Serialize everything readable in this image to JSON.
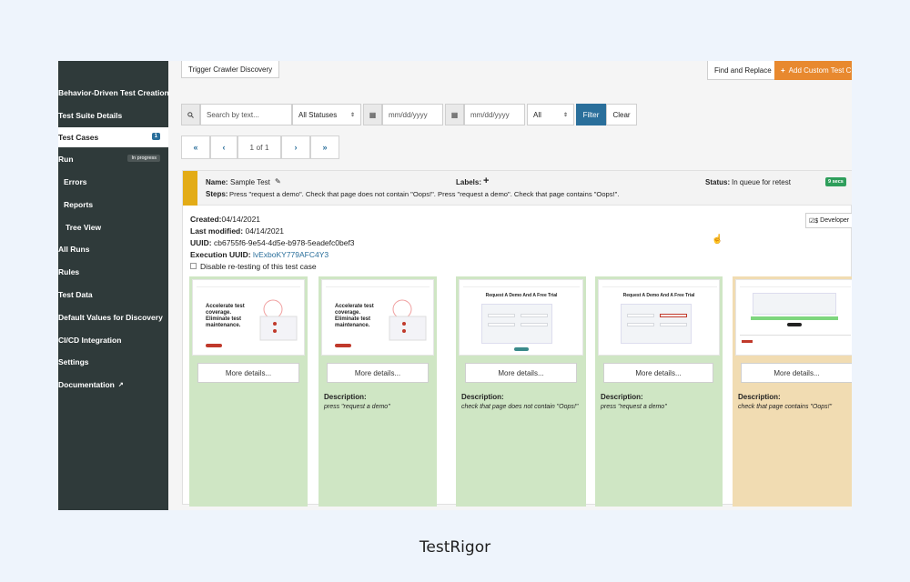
{
  "sidebar": {
    "items": [
      {
        "label": "Behavior-Driven Test Creation"
      },
      {
        "label": "Test Suite Details"
      },
      {
        "label": "Test Cases",
        "badge": "1"
      },
      {
        "label": "Run",
        "pill": "In progress"
      },
      {
        "label": "Errors"
      },
      {
        "label": "Reports"
      },
      {
        "label": "Tree View"
      },
      {
        "label": "All Runs"
      },
      {
        "label": "Rules"
      },
      {
        "label": "Test Data"
      },
      {
        "label": "Default Values for Discovery"
      },
      {
        "label": "CI/CD Integration"
      },
      {
        "label": "Settings"
      },
      {
        "label": "Documentation"
      }
    ]
  },
  "toolbar": {
    "trigger_label": "Trigger Crawler Discovery",
    "find_replace_label": "Find and Replace",
    "add_custom_label": "Add Custom Test C"
  },
  "filters": {
    "search_placeholder": "Search by text...",
    "status_value": "All Statuses",
    "date_from_placeholder": "mm/dd/yyyy",
    "date_to_placeholder": "mm/dd/yyyy",
    "scope_value": "All",
    "filter_label": "Filter",
    "clear_label": "Clear"
  },
  "pager": {
    "first": "«",
    "prev": "‹",
    "page_text": "1 of 1",
    "next": "›",
    "last": "»"
  },
  "test_case": {
    "name_label": "Name:",
    "name_value": "Sample Test",
    "labels_label": "Labels:",
    "status_label": "Status:",
    "status_value": "In queue for retest",
    "pass_badge": "9 secs",
    "steps_label": "Steps:",
    "steps_value": "Press \"request a demo\". Check that page does not contain \"Oops!\". Press \"request a demo\". Check that page contains \"Oops!\".",
    "created_label": "Created:",
    "created_value": "04/14/2021",
    "modified_label": "Last modified:",
    "modified_value": "04/14/2021",
    "uuid_label": "UUID:",
    "uuid_value": "cb6755f6-9e54-4d5e-b978-5eadefc0bef3",
    "exec_uuid_label": "Execution UUID:",
    "exec_uuid_value": "lvExboKY779AFC4Y3",
    "disable_retest_label": "Disable re-testing of this test case",
    "developer_label": "Developer"
  },
  "screenshots": [
    {
      "more": "More details...",
      "desc_label": "",
      "desc": "",
      "mini_title": "Accelerate test coverage. Eliminate test maintenance."
    },
    {
      "more": "More details...",
      "desc_label": "Description:",
      "desc": "press \"request a demo\"",
      "mini_title": "Accelerate test coverage. Eliminate test maintenance."
    },
    {
      "more": "More details...",
      "desc_label": "Description:",
      "desc": "check that page does not contain \"Oops!\"",
      "mini_title": "Request A Demo And A Free Trial"
    },
    {
      "more": "More details...",
      "desc_label": "Description:",
      "desc": "press \"request a demo\"",
      "mini_title": "Request A Demo And A Free Trial"
    },
    {
      "more": "More details...",
      "desc_label": "Description:",
      "desc": "check that page contains \"Oops!\"",
      "mini_title": ""
    }
  ],
  "caption": "TestRigor",
  "colors": {
    "sidebar_bg": "#2f3a3a",
    "accent_blue": "#2a6f9b",
    "accent_orange": "#e8892f",
    "status_bar": "#e3ac17",
    "pass_green": "#2e9e5b",
    "step_green": "#cfe6c4",
    "step_orange": "#f1dcb2"
  }
}
